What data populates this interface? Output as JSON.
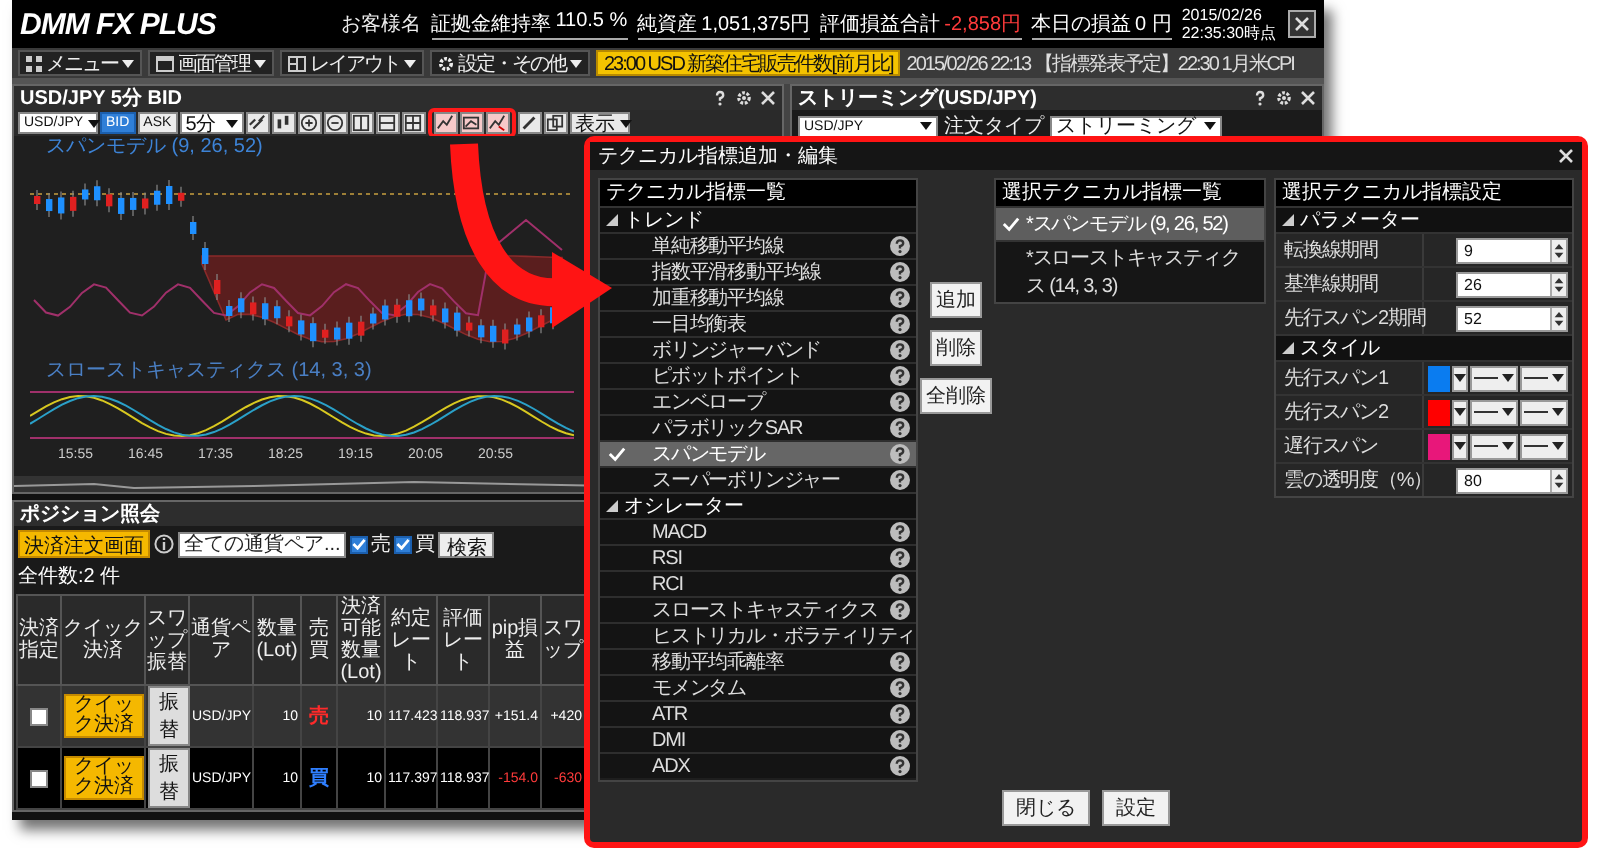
{
  "app": {
    "logo": "DMM FX PLUS",
    "account_name": "お客様名",
    "stats": [
      {
        "label": "証拠金維持率",
        "value": "110.5 %",
        "negative": false
      },
      {
        "label": "純資産",
        "value": "1,051,375円",
        "negative": false
      },
      {
        "label": "評価損益合計",
        "value": "-2,858円",
        "negative": true
      },
      {
        "label": "本日の損益",
        "value": "0 円",
        "negative": false
      }
    ],
    "date": "2015/02/26",
    "time": "22:35:30時点",
    "menu": [
      {
        "label": "メニュー",
        "kind": "grid"
      },
      {
        "label": "画面管理",
        "kind": "window"
      },
      {
        "label": "レイアウト",
        "kind": "layout"
      },
      {
        "label": "設定・その他",
        "kind": "gear"
      }
    ],
    "ticker": "23:00 USD 新築住宅販売件数[前月比]",
    "news": "2015/02/26 22:13 【指標発表予定】22:30 1月米CPI",
    "chart_panel": {
      "title": "USD/JPY 5分 BID",
      "pair": "USD/JPY",
      "price_modes": [
        {
          "label": "BID",
          "selected": true
        },
        {
          "label": "ASK",
          "selected": false
        }
      ],
      "interval": "5分",
      "display": "表示",
      "price_label": "スパンモデル (9, 26, 52)",
      "oscillator_label": "スローストキャスティクス (14, 3, 3)",
      "times": [
        "15:55",
        "16:45",
        "17:35",
        "18:25",
        "19:15",
        "20:05",
        "20:55"
      ]
    },
    "streaming": {
      "title": "ストリーミング(USD/JPY)",
      "pair": "USD/JPY",
      "order_type_label": "注文タイプ",
      "order_type": "ストリーミング"
    },
    "positions": {
      "title": "ポジション照会",
      "settle_button": "決済注文画面",
      "pair_filter": "全ての通貨ペア...",
      "filters": [
        {
          "label": "売",
          "checked": true
        },
        {
          "label": "買",
          "checked": true
        }
      ],
      "search": "検索",
      "count": "全件数:2 件",
      "columns": [
        "決済指定",
        "クイック決済",
        "スワップ振替",
        "通貨ペア",
        "数量(Lot)",
        "売買",
        "決済可能数量(Lot)",
        "約定レート",
        "評価レート",
        "pip損益",
        "スワップ"
      ],
      "rows": [
        {
          "checked": false,
          "quick": "クイック決済",
          "swap": "振替",
          "pair": "USD/JPY",
          "qty": "10",
          "side": {
            "label": "売",
            "kind": "sell"
          },
          "settleable": "10",
          "rate": "117.423",
          "eval": "118.937",
          "pips": "+151.4",
          "swap_points": "+420",
          "negative": false
        },
        {
          "checked": false,
          "quick": "クイック決済",
          "swap": "振替",
          "pair": "USD/JPY",
          "qty": "10",
          "side": {
            "label": "買",
            "kind": "buy"
          },
          "settleable": "10",
          "rate": "117.397",
          "eval": "118.937",
          "pips": "-154.0",
          "swap_points": "-630",
          "negative": true
        }
      ]
    }
  },
  "dialog": {
    "title": "テクニカル指標追加・編集",
    "indicators": {
      "title": "テクニカル指標一覧",
      "groups": [
        {
          "label": "トレンド",
          "expanded": true,
          "children": [
            {
              "label": "単純移動平均線",
              "selected": false
            },
            {
              "label": "指数平滑移動平均線",
              "selected": false
            },
            {
              "label": "加重移動平均線",
              "selected": false
            },
            {
              "label": "一目均衡表",
              "selected": false
            },
            {
              "label": "ボリンジャーバンド",
              "selected": false
            },
            {
              "label": "ピボットポイント",
              "selected": false
            },
            {
              "label": "エンベロープ",
              "selected": false
            },
            {
              "label": "パラボリックSAR",
              "selected": false
            },
            {
              "label": "スパンモデル",
              "selected": true
            },
            {
              "label": "スーパーボリンジャー",
              "selected": false
            }
          ]
        },
        {
          "label": "オシレーター",
          "expanded": true,
          "children": [
            {
              "label": "MACD",
              "selected": false
            },
            {
              "label": "RSI",
              "selected": false
            },
            {
              "label": "RCI",
              "selected": false
            },
            {
              "label": "スローストキャスティクス",
              "selected": false
            },
            {
              "label": "ヒストリカル・ボラティリティ",
              "selected": false
            },
            {
              "label": "移動平均乖離率",
              "selected": false
            },
            {
              "label": "モメンタム",
              "selected": false
            },
            {
              "label": "ATR",
              "selected": false
            },
            {
              "label": "DMI",
              "selected": false
            },
            {
              "label": "ADX",
              "selected": false
            }
          ]
        }
      ]
    },
    "action_buttons": [
      "追加",
      "削除",
      "全削除"
    ],
    "selected_indicators": {
      "title": "選択テクニカル指標一覧",
      "items": [
        {
          "label": "*スパンモデル (9, 26, 52)",
          "selected": true
        },
        {
          "label": "*スローストキャスティクス (14, 3, 3)",
          "selected": false
        }
      ]
    },
    "settings": {
      "title": "選択テクニカル指標設定",
      "groups": [
        {
          "label": "パラメーター",
          "expanded": true,
          "children": [
            {
              "kind": "number",
              "label": "転換線期間",
              "value": "9"
            },
            {
              "kind": "number",
              "label": "基準線期間",
              "value": "26"
            },
            {
              "kind": "number",
              "label": "先行スパン2期間",
              "value": "52"
            }
          ]
        },
        {
          "label": "スタイル",
          "expanded": true,
          "children": [
            {
              "kind": "style",
              "label": "先行スパン1",
              "color": "#0a7cf0"
            },
            {
              "kind": "style",
              "label": "先行スパン2",
              "color": "#ff0000"
            },
            {
              "kind": "style",
              "label": "遅行スパン",
              "color": "#e8177a"
            },
            {
              "kind": "number",
              "label": "雲の透明度（%）",
              "value": "80"
            }
          ]
        }
      ]
    },
    "footer_buttons": [
      "閉じる",
      "設定"
    ]
  }
}
